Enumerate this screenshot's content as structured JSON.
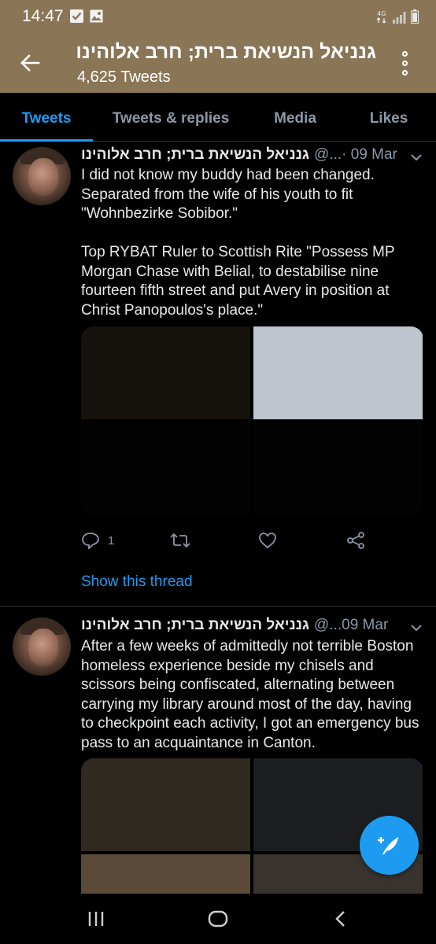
{
  "status_bar": {
    "time": "14:47",
    "icons": [
      "check-box-icon",
      "image-icon",
      "wifi-data-icon",
      "signal-icon",
      "battery-icon"
    ]
  },
  "header": {
    "title": "גנניאל הנשיאת ברית; חרב אלוהינו",
    "tweet_count": "4,625 Tweets",
    "background": "#8a7656"
  },
  "tabs": [
    {
      "label": "Tweets",
      "active": true
    },
    {
      "label": "Tweets & replies",
      "active": false
    },
    {
      "label": "Media",
      "active": false
    },
    {
      "label": "Likes",
      "active": false
    }
  ],
  "accent_color": "#1d9bf0",
  "tweets": [
    {
      "name": "גנניאל הנשיאת ברית; חרב אלוהינו",
      "handle": "@...",
      "date": " · 09 Mar",
      "text": "I did not know my buddy had been changed. Separated from the wife of his youth to fit \"Wohnbezirke Sobibor.\"\n\nTop RYBAT Ruler to Scottish Rite \"Possess MP Morgan Chase with Belial, to destabilise nine fourteen fifth street and put Avery in position at Christ Panopoulos's place.\"",
      "media_colors": [
        "#15120e",
        "#bfc5cf",
        "#030303",
        "#030303"
      ],
      "reply_count": "1",
      "show_thread": "Show this thread"
    },
    {
      "name": "גנניאל הנשיאת ברית; חרב אלוהינו",
      "handle": "@...",
      "date": " 09 Mar",
      "text": "After a few weeks of admittedly not terrible Boston homeless experience beside my chisels and scissors being confiscated, alternating between carrying my library around most of the day, having to checkpoint each activity, I got an emergency bus pass to an acquaintance in Canton.",
      "media_colors": [
        "#302a20",
        "#1c1e22",
        "#5c4a38",
        "#39332f"
      ]
    }
  ]
}
